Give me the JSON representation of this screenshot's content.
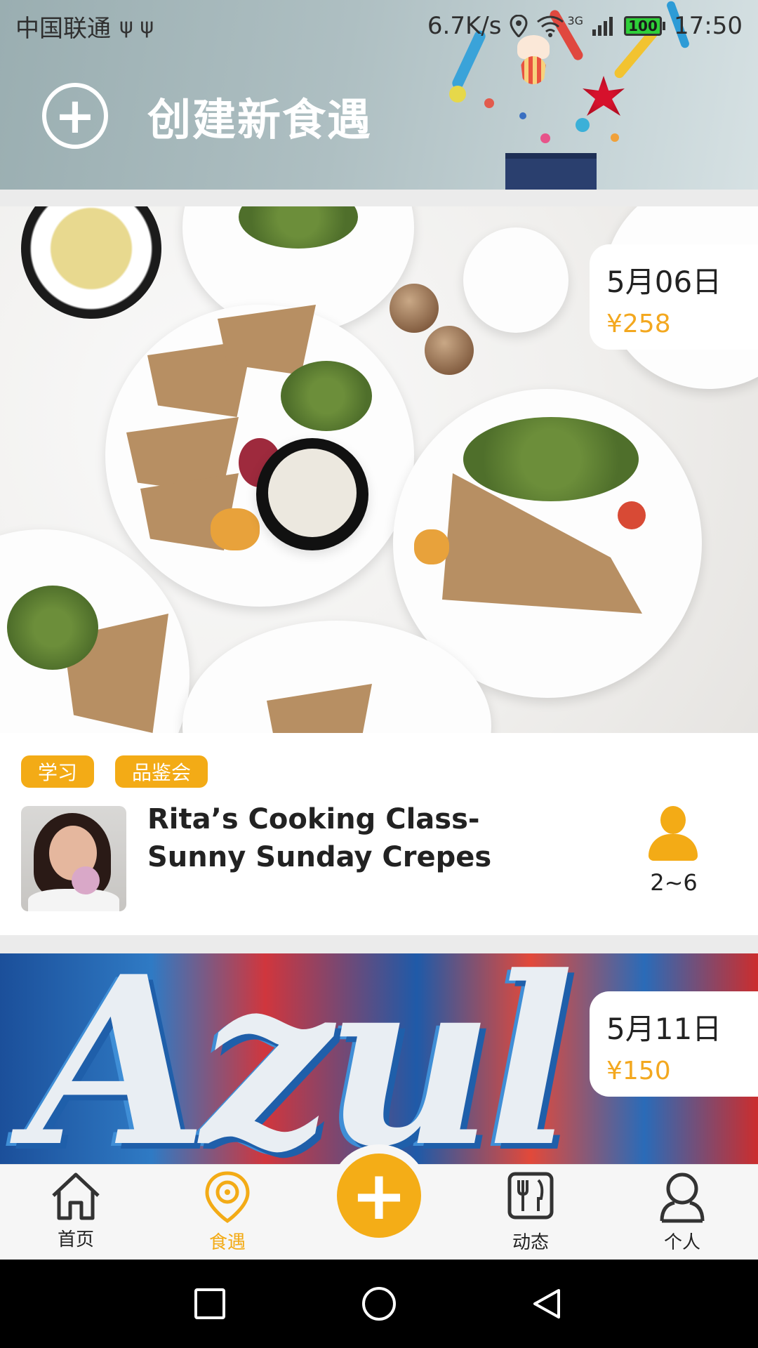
{
  "status_bar": {
    "carrier": "中国联通",
    "usb_icons": "ψ ψ",
    "net_speed": "6.7K/s",
    "network_label": "3G",
    "battery": "100",
    "time": "17:50"
  },
  "header": {
    "create_title": "创建新食遇"
  },
  "events": [
    {
      "date": "5月06日",
      "price": "¥258",
      "tags": [
        "学习",
        "品鉴会"
      ],
      "title": "Rita’s Cooking Class-Sunny Sunday Crepes",
      "capacity": "2~6"
    },
    {
      "date": "5月11日",
      "price": "¥150"
    }
  ],
  "bottom_nav": {
    "items": [
      {
        "label": "首页",
        "icon": "home-icon"
      },
      {
        "label": "食遇",
        "icon": "location-pin-icon",
        "active": true
      },
      {
        "label": "",
        "icon": "add-icon"
      },
      {
        "label": "动态",
        "icon": "fork-knife-icon"
      },
      {
        "label": "个人",
        "icon": "profile-icon"
      }
    ]
  },
  "colors": {
    "accent": "#f3ab16",
    "text": "#222222",
    "card_bg": "#ffffff",
    "page_bg": "#ebebeb"
  }
}
